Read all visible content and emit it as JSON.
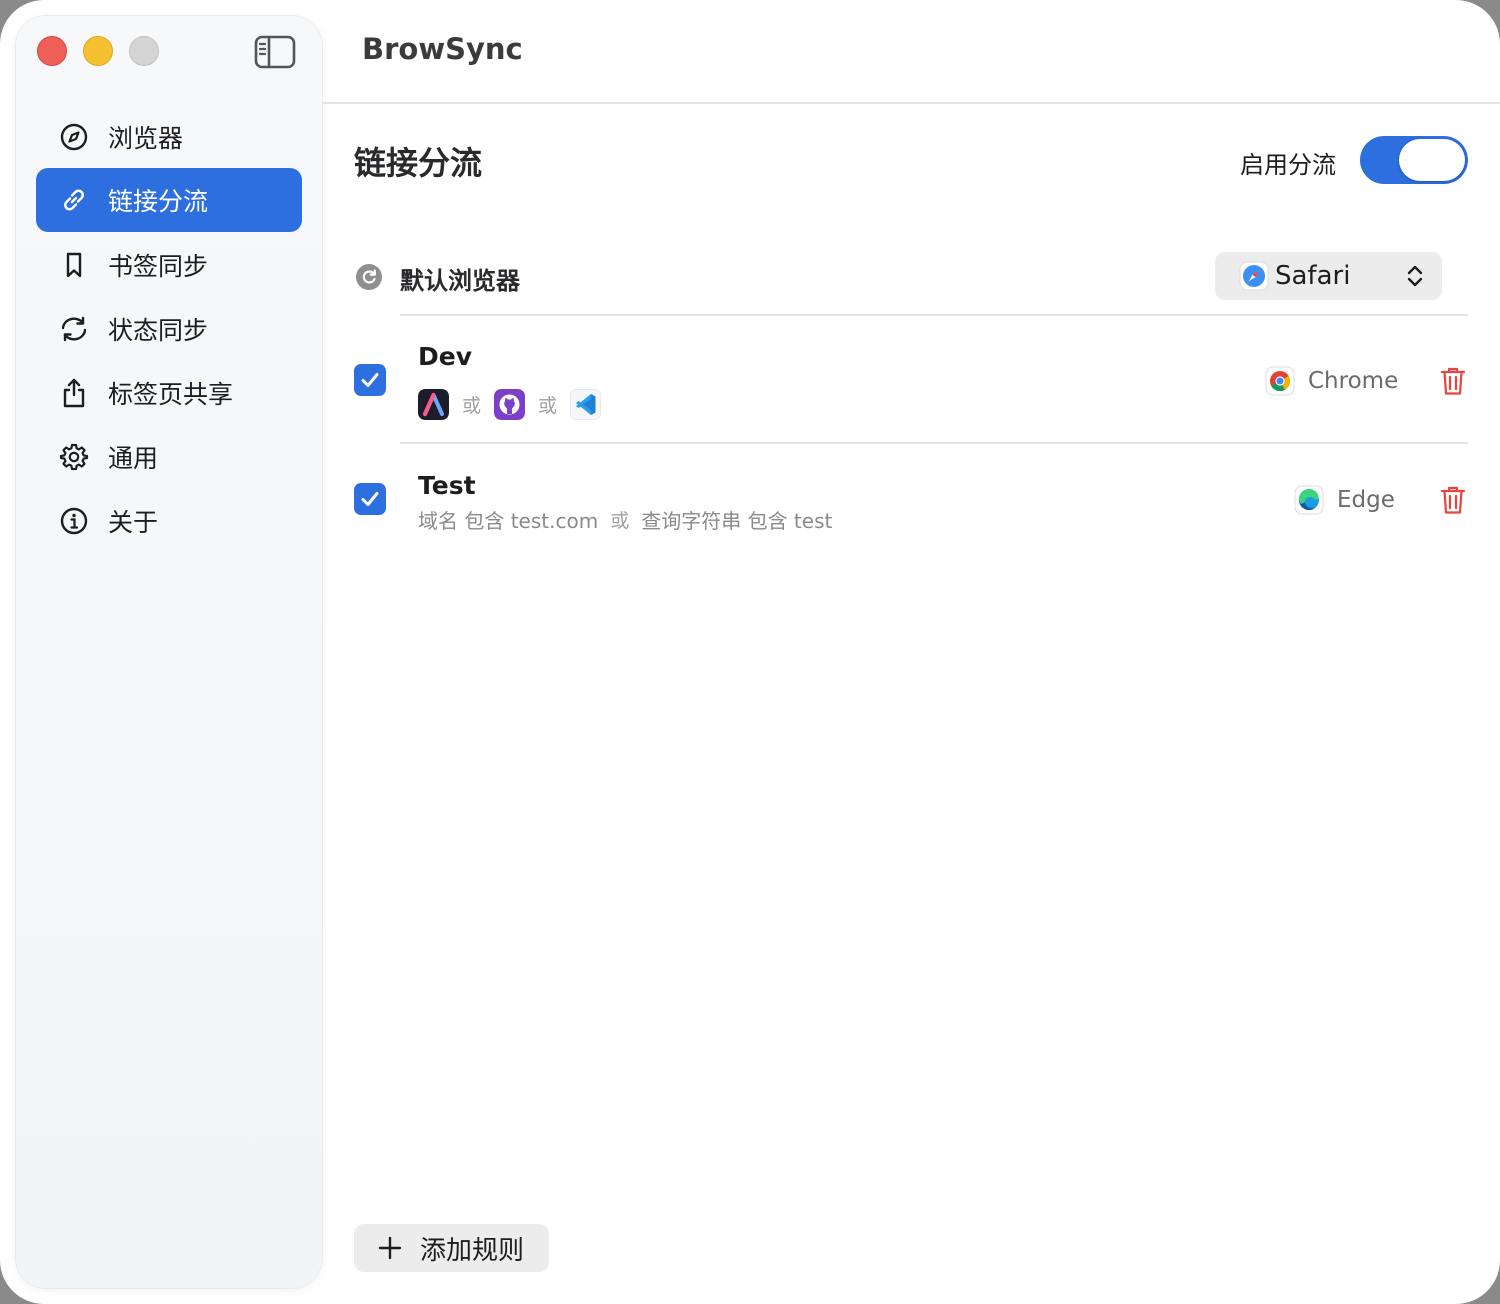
{
  "window": {
    "title": "BrowSync"
  },
  "sidebar": {
    "items": [
      {
        "label": "浏览器",
        "icon": "compass-icon",
        "active": false
      },
      {
        "label": "链接分流",
        "icon": "link-icon",
        "active": true
      },
      {
        "label": "书签同步",
        "icon": "bookmark-icon",
        "active": false
      },
      {
        "label": "状态同步",
        "icon": "sync-icon",
        "active": false
      },
      {
        "label": "标签页共享",
        "icon": "share-icon",
        "active": false
      },
      {
        "label": "通用",
        "icon": "gear-icon",
        "active": false
      },
      {
        "label": "关于",
        "icon": "info-icon",
        "active": false
      }
    ]
  },
  "main": {
    "section_title": "链接分流",
    "enable_label": "启用分流",
    "enabled": true,
    "default_browser": {
      "label": "默认浏览器",
      "selected": "Safari"
    },
    "rules": [
      {
        "name": "Dev",
        "checked": true,
        "conditions": [
          "app-icon-a",
          "app-icon-github",
          "app-icon-vscode"
        ],
        "or_label": "或",
        "target": "Chrome"
      },
      {
        "name": "Test",
        "checked": true,
        "desc_1": "域名 包含 test.com",
        "or_label": "或",
        "desc_2": "查询字符串 包含 test",
        "target": "Edge"
      }
    ],
    "add_rule_label": "添加规则"
  },
  "colors": {
    "accent": "#2e6fe0",
    "delete": "#e8453c",
    "close": "#ee5f57",
    "minimize": "#f5c130",
    "zoom": "#d4d4d4"
  }
}
